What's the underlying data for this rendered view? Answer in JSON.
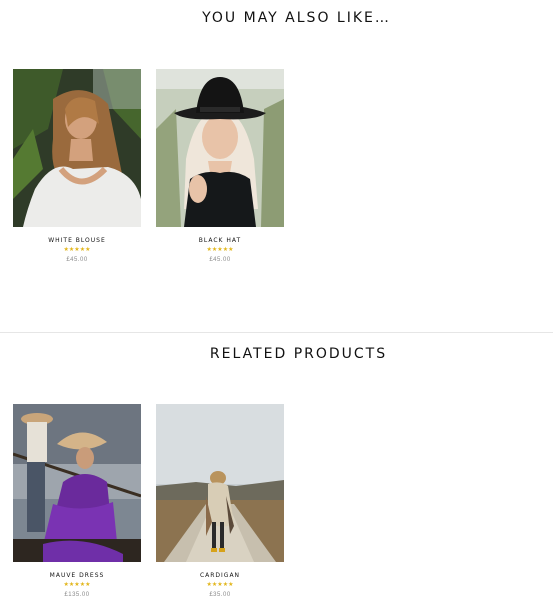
{
  "sections": [
    {
      "title": "YOU MAY ALSO LIKE…",
      "products": [
        {
          "name": "WHITE BLOUSE",
          "rating": 4.5,
          "price": "£45.00",
          "image": "woman-white-blouse-photo"
        },
        {
          "name": "BLACK HAT",
          "rating": 4.5,
          "price": "£45.00",
          "image": "woman-black-hat-photo"
        }
      ]
    },
    {
      "title": "RELATED PRODUCTS",
      "products": [
        {
          "name": "MAUVE DRESS",
          "rating": 5,
          "price": "£135.00",
          "image": "woman-mauve-dress-photo"
        },
        {
          "name": "CARDIGAN",
          "rating": 5,
          "price": "£35.00",
          "image": "woman-cardigan-photo"
        }
      ]
    }
  ],
  "colors": {
    "star": "#e2b61c",
    "star_empty": "#d9d9d9",
    "price": "#8a8a8a"
  }
}
